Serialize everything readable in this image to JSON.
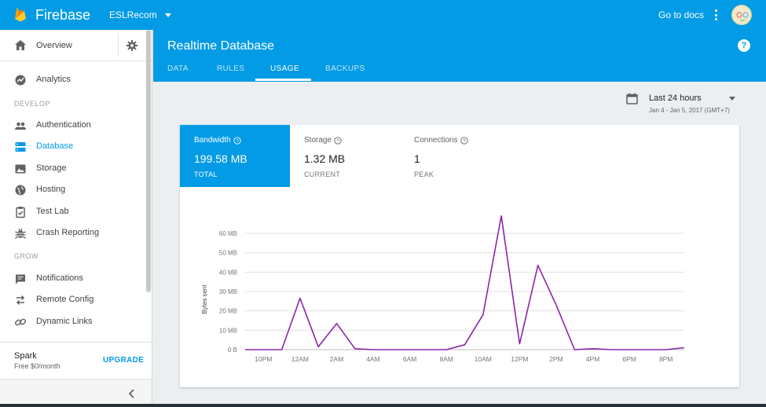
{
  "topbar": {
    "brand": "Firebase",
    "project": "ESLRecom",
    "docs_link": "Go to docs"
  },
  "sidebar": {
    "overview": "Overview",
    "analytics": "Analytics",
    "sections": [
      {
        "header": "DEVELOP",
        "items": [
          {
            "label": "Authentication",
            "icon": "people-icon"
          },
          {
            "label": "Database",
            "icon": "database-icon",
            "active": true
          },
          {
            "label": "Storage",
            "icon": "image-icon"
          },
          {
            "label": "Hosting",
            "icon": "globe-icon"
          },
          {
            "label": "Test Lab",
            "icon": "clipboard-check-icon"
          },
          {
            "label": "Crash Reporting",
            "icon": "bug-icon"
          }
        ]
      },
      {
        "header": "GROW",
        "items": [
          {
            "label": "Notifications",
            "icon": "message-icon"
          },
          {
            "label": "Remote Config",
            "icon": "swap-icon"
          },
          {
            "label": "Dynamic Links",
            "icon": "link-icon"
          }
        ]
      }
    ],
    "plan": {
      "name": "Spark",
      "price": "Free $0/month",
      "upgrade": "UPGRADE"
    }
  },
  "header": {
    "title": "Realtime Database",
    "tabs": [
      "DATA",
      "RULES",
      "USAGE",
      "BACKUPS"
    ],
    "active_tab": "USAGE"
  },
  "date_range": {
    "label": "Last 24 hours",
    "detail": "Jan 4 - Jan 5, 2017 (GMT+7)"
  },
  "stats": [
    {
      "label": "Bandwidth",
      "value": "199.58 MB",
      "sub": "TOTAL",
      "active": true
    },
    {
      "label": "Storage",
      "value": "1.32 MB",
      "sub": "CURRENT"
    },
    {
      "label": "Connections",
      "value": "1",
      "sub": "PEAK"
    }
  ],
  "colors": {
    "brand": "#039be5",
    "line": "#8e24aa",
    "background": "#eceff1"
  },
  "chart_data": {
    "type": "line",
    "ylabel": "Bytes sent",
    "xlabel": "",
    "y_ticks": [
      "0 B",
      "10 MB",
      "20 MB",
      "30 MB",
      "40 MB",
      "50 MB",
      "60 MB"
    ],
    "x_ticks": [
      "10PM",
      "12AM",
      "2AM",
      "4AM",
      "6AM",
      "8AM",
      "10AM",
      "12PM",
      "2PM",
      "4PM",
      "6PM",
      "8PM"
    ],
    "ylim": [
      0,
      60
    ],
    "y_unit": "MB",
    "grid": true,
    "series": [
      {
        "x": [
          0,
          1,
          2,
          3,
          4,
          5,
          6,
          7,
          8,
          9,
          10,
          11,
          12,
          13,
          14,
          15,
          16,
          17,
          18,
          19,
          20,
          21,
          22,
          23,
          24
        ],
        "values": [
          0,
          0,
          0,
          26.5,
          1.5,
          13.5,
          0.5,
          0,
          0,
          0,
          0,
          0,
          2.5,
          18,
          69,
          3,
          43.5,
          23,
          0,
          0.5,
          0,
          0,
          0,
          0,
          1
        ]
      }
    ]
  }
}
